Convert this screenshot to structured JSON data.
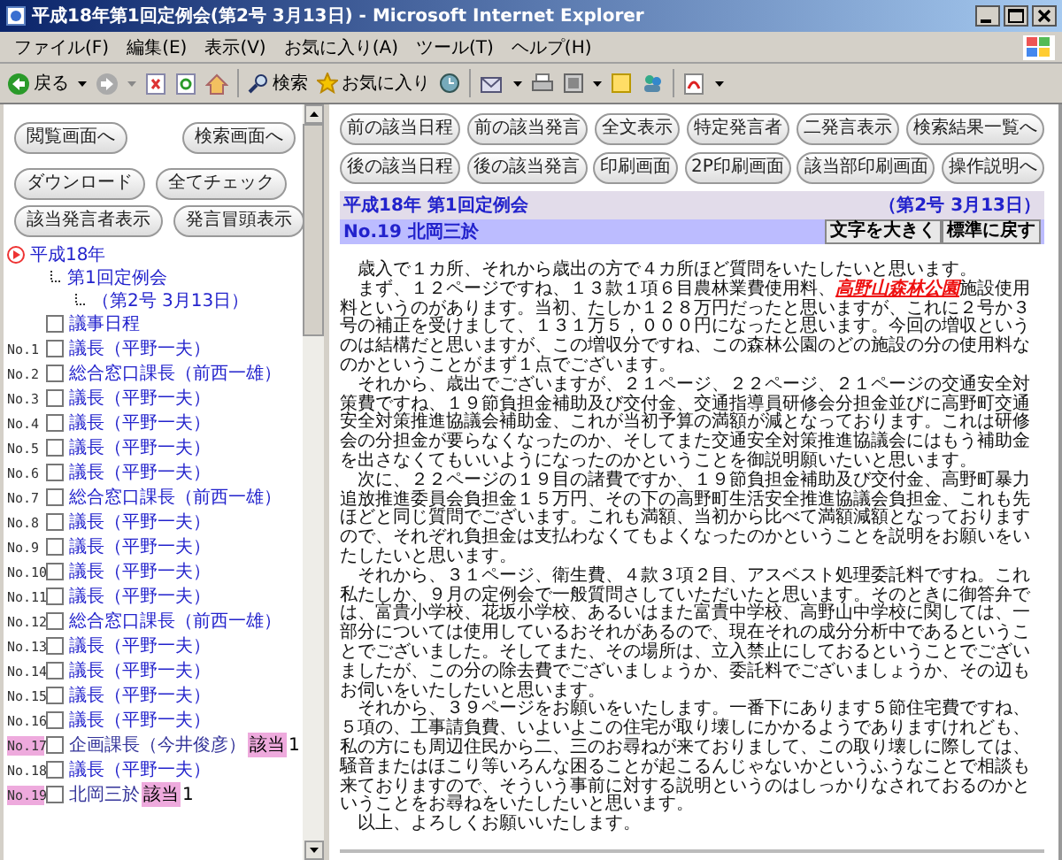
{
  "window": {
    "title": "平成18年第1回定例会(第2号 3月13日) - Microsoft Internet Explorer"
  },
  "menu": [
    "ファイル(F)",
    "編集(E)",
    "表示(V)",
    "お気に入り(A)",
    "ツール(T)",
    "ヘルプ(H)"
  ],
  "toolbar": {
    "back": "戻る",
    "search": "検索",
    "favorites": "お気に入り"
  },
  "sidebar": {
    "nav_buttons": [
      "閲覧画面へ",
      "検索画面へ"
    ],
    "action_buttons": [
      "ダウンロード",
      "全てチェック"
    ],
    "view_buttons": [
      "該当発言者表示",
      "発言冒頭表示"
    ],
    "tree": {
      "year": "平成18年",
      "session": "第1回定例会",
      "issue": "（第2号 3月13日）"
    },
    "items": [
      {
        "name": "議事日程",
        "checked": false,
        "highlighted": false
      },
      {
        "number": "No.1",
        "name": "議長（平野一夫）",
        "checked": false,
        "highlighted": false
      },
      {
        "number": "No.2",
        "name": "総合窓口課長（前西一雄）",
        "checked": false,
        "highlighted": false
      },
      {
        "number": "No.3",
        "name": "議長（平野一夫）",
        "checked": false,
        "highlighted": false
      },
      {
        "number": "No.4",
        "name": "議長（平野一夫）",
        "checked": false,
        "highlighted": false
      },
      {
        "number": "No.5",
        "name": "議長（平野一夫）",
        "checked": false,
        "highlighted": false
      },
      {
        "number": "No.6",
        "name": "議長（平野一夫）",
        "checked": false,
        "highlighted": false
      },
      {
        "number": "No.7",
        "name": "総合窓口課長（前西一雄）",
        "checked": false,
        "highlighted": false
      },
      {
        "number": "No.8",
        "name": "議長（平野一夫）",
        "checked": false,
        "highlighted": false
      },
      {
        "number": "No.9",
        "name": "議長（平野一夫）",
        "checked": false,
        "highlighted": false
      },
      {
        "number": "No.10",
        "name": "議長（平野一夫）",
        "checked": false,
        "highlighted": false
      },
      {
        "number": "No.11",
        "name": "議長（平野一夫）",
        "checked": false,
        "highlighted": false
      },
      {
        "number": "No.12",
        "name": "総合窓口課長（前西一雄）",
        "checked": false,
        "highlighted": false
      },
      {
        "number": "No.13",
        "name": "議長（平野一夫）",
        "checked": false,
        "highlighted": false
      },
      {
        "number": "No.14",
        "name": "議長（平野一夫）",
        "checked": false,
        "highlighted": false
      },
      {
        "number": "No.15",
        "name": "議長（平野一夫）",
        "checked": false,
        "highlighted": false
      },
      {
        "number": "No.16",
        "name": "議長（平野一夫）",
        "checked": false,
        "highlighted": false
      },
      {
        "number": "No.17",
        "name": "企画課長（今井俊彦）",
        "checked": false,
        "highlighted": true,
        "hit_label": "該当",
        "hit_count": "1"
      },
      {
        "number": "No.18",
        "name": "議長（平野一夫）",
        "checked": false,
        "highlighted": false
      },
      {
        "number": "No.19",
        "name": "北岡三於",
        "checked": false,
        "highlighted": true,
        "hit_label": "該当",
        "hit_count": "1"
      }
    ]
  },
  "main": {
    "button_rows": [
      [
        "前の該当日程",
        "前の該当発言",
        "全文表示",
        "特定発言者",
        "二発言表示",
        "検索結果一覧へ"
      ],
      [
        "後の該当日程",
        "後の該当発言",
        "印刷画面",
        "2P印刷画面",
        "該当部印刷画面",
        "操作説明へ"
      ]
    ],
    "session_title": "平成18年 第1回定例会",
    "session_date": "（第2号 3月13日）",
    "speaker": "No.19 北岡三於",
    "font_buttons": [
      "文字を大きく",
      "標準に戻す"
    ],
    "paragraphs": [
      [
        {
          "kind": "text",
          "text": "歳入で１カ所、それから歳出の方で４カ所ほど質問をいたしたいと思います。"
        }
      ],
      [
        {
          "kind": "text",
          "text": "まず、１２ページですね、１３款１項６目農林業費使用料、"
        },
        {
          "kind": "hit",
          "text": "高野山森林公園"
        },
        {
          "kind": "text",
          "text": "施設使用料というのがあります。当初、たしか１２８万円だったと思いますが、これに２号か３号の補正を受けまして、１３１万５，０００円になったと思います。今回の増収というのは結構だと思いますが、この増収分ですね、この森林公園のどの施設の分の使用料なのかということがまず１点でございます。"
        }
      ],
      [
        {
          "kind": "text",
          "text": "それから、歳出でございますが、２１ページ、２２ページ、２１ページの交通安全対策費ですね、１９節負担金補助及び交付金、交通指導員研修会分担金並びに高野町交通安全対策推進協議会補助金、これが当初予算の満額が減となっております。これは研修会の分担金が要らなくなったのか、そしてまた交通安全対策推進協議会にはもう補助金を出さなくてもいいようになったのかということを御説明願いたいと思います。"
        }
      ],
      [
        {
          "kind": "text",
          "text": "次に、２２ページの１９目の諸費ですか、１９節負担金補助及び交付金、高野町暴力追放推進委員会負担金１５万円、その下の高野町生活安全推進協議会負担金、これも先ほどと同じ質問でございます。これも満額、当初から比べて満額減額となっておりますので、それぞれ負担金は支払わなくてもよくなったのかということを説明をお願いをいたしたいと思います。"
        }
      ],
      [
        {
          "kind": "text",
          "text": "それから、３１ページ、衛生費、４款３項２目、アスベスト処理委託料ですね。これ私たしか、９月の定例会で一般質問さしていただいたと思います。そのときに御答弁では、富貴小学校、花坂小学校、あるいはまた富貴中学校、高野山中学校に関しては、一部分については使用しているおそれがあるので、現在それの成分分析中であるということでございました。そしてまた、その場所は、立入禁止にしておるということでございましたが、この分の除去費でございましょうか、委託料でございましょうか、その辺もお伺いをいたしたいと思います。"
        }
      ],
      [
        {
          "kind": "text",
          "text": "それから、３９ページをお願いをいたします。一番下にあります５節住宅費ですね、５項の、工事請負費、いよいよこの住宅が取り壊しにかかるようでありますけれども、私の方にも周辺住民から二、三のお尋ねが来ておりまして、この取り壊しに際しては、騒音またはほこり等いろんな困ることが起こるんじゃないかというふうなことで相談も来ておりますので、そういう事前に対する説明というのはしっかりなされておるのかということをお尋ねをいたしたいと思います。"
        }
      ],
      [
        {
          "kind": "text",
          "text": "以上、よろしくお願いいたします。"
        }
      ]
    ]
  }
}
